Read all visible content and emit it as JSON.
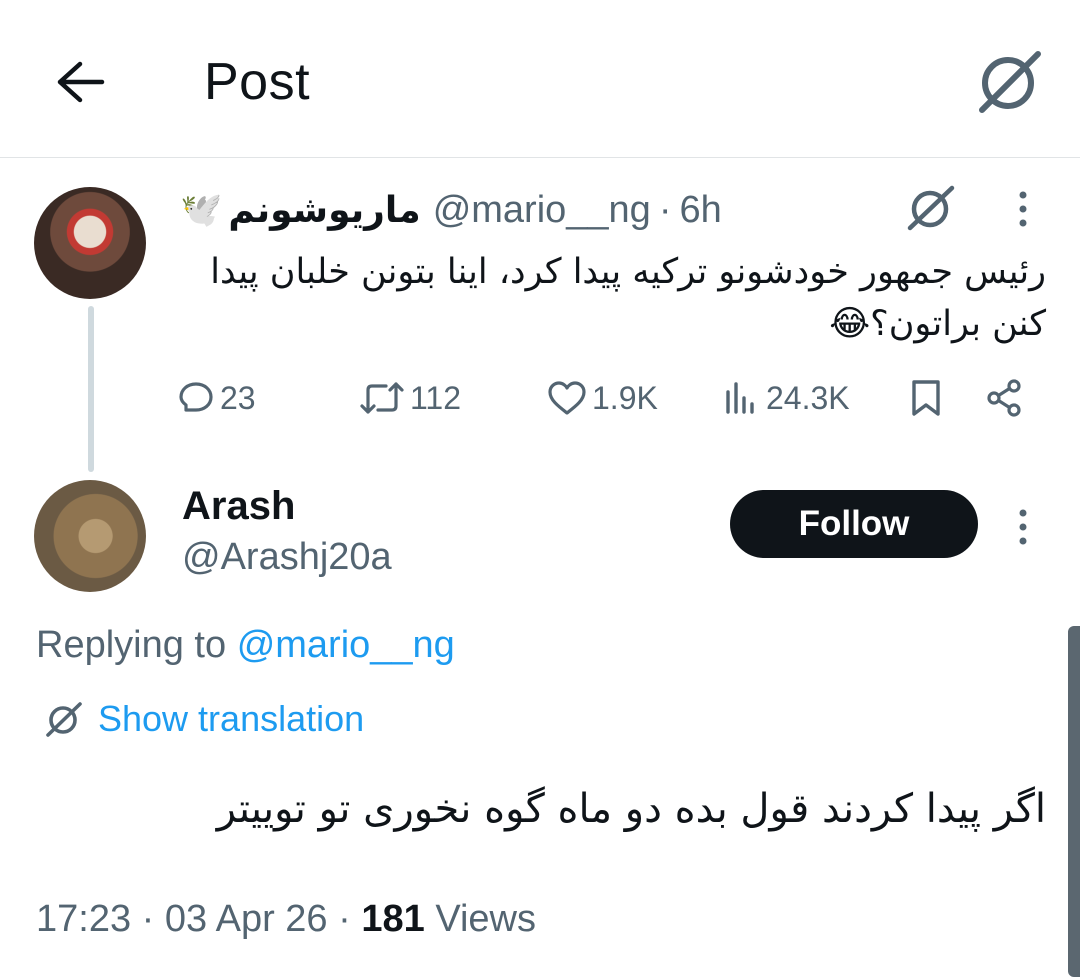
{
  "header": {
    "title": "Post",
    "back_icon": "arrow-left-icon",
    "grok_icon": "grok-icon"
  },
  "parent_post": {
    "author_name": "ماریوشونم",
    "author_emoji": "🕊️",
    "handle": "@mario__ng",
    "separator": "·",
    "time": "6h",
    "text": "رئیس جمهور خودشونو ترکیه پیدا کرد، اینا بتونن خلبان پیدا کنن براتون؟😂",
    "stats": {
      "replies": "23",
      "reposts": "112",
      "likes": "1.9K",
      "views": "24.3K"
    }
  },
  "reply": {
    "author_name": "Arash",
    "handle": "@Arashj20a",
    "follow_label": "Follow",
    "replying_prefix": "Replying to",
    "replying_handle": "@mario__ng",
    "show_translation": "Show translation",
    "text": "اگر پیدا کردند قول بده دو ماه گوه نخوری تو توییتر",
    "timestamp": "17:23",
    "separator": "·",
    "date": "03 Apr 26",
    "views_count": "181",
    "views_label": "Views"
  },
  "colors": {
    "text": "#0f1419",
    "muted": "#536471",
    "link": "#1d9bf0",
    "button": "#0f1419",
    "divider": "#e1e4e6"
  }
}
